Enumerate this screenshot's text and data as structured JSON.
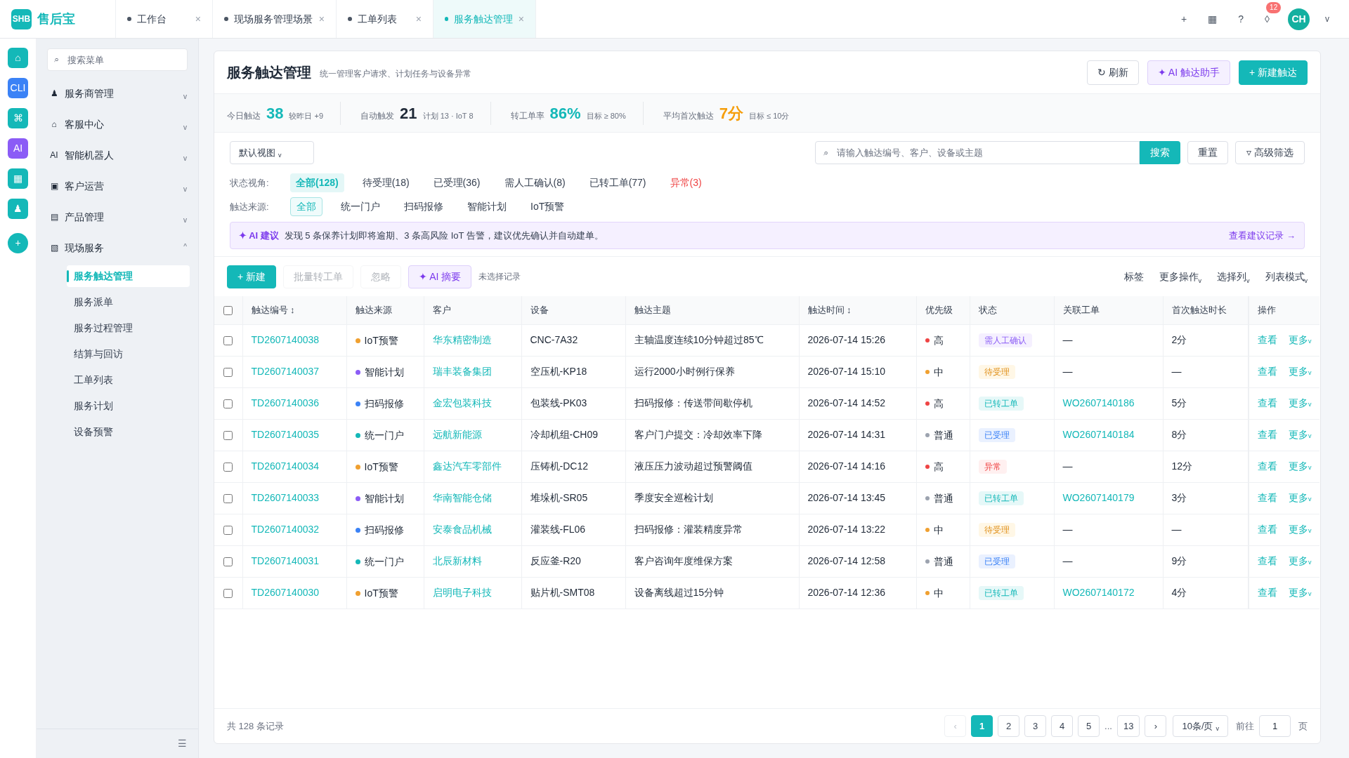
{
  "app": {
    "logo": "SHB",
    "name": "售后宝"
  },
  "tabs": [
    {
      "label": "工作台",
      "selected": false,
      "close": "×"
    },
    {
      "label": "现场服务管理场景",
      "selected": false,
      "close": "×"
    },
    {
      "label": "工单列表",
      "selected": false,
      "close": "×"
    },
    {
      "label": "服务触达管理",
      "selected": true,
      "close": "×"
    }
  ],
  "topbar": {
    "actions": [
      "+",
      "▦",
      "?",
      "◊"
    ],
    "badge": "12",
    "avatar": "CH",
    "caret": "v"
  },
  "rail": [
    {
      "text": "⌂",
      "color": "#14b8b8"
    },
    {
      "text": "CLI",
      "color": "#3b82f6"
    },
    {
      "text": "⌘",
      "color": "#14b8b8"
    },
    {
      "text": "AI",
      "color": "#8b5cf6"
    },
    {
      "text": "▦",
      "color": "#14b8b8"
    },
    {
      "text": "♟",
      "color": "#14b8b8"
    },
    {
      "text": "+",
      "color": "#14b8b8"
    }
  ],
  "sidebar": {
    "search": {
      "icon": "⌕",
      "placeholder": "搜索菜单"
    },
    "items": [
      {
        "icon": "♟",
        "label": "服务商管理",
        "expanded": false,
        "caret": "v"
      },
      {
        "icon": "⌂",
        "label": "客服中心",
        "expanded": false,
        "caret": "v"
      },
      {
        "icon": "AI",
        "label": "智能机器人",
        "expanded": false,
        "caret": "v"
      },
      {
        "icon": "▣",
        "label": "客户运营",
        "expanded": false,
        "caret": "v"
      },
      {
        "icon": "▤",
        "label": "产品管理",
        "expanded": false,
        "caret": "v"
      },
      {
        "icon": "▧",
        "label": "现场服务",
        "expanded": true,
        "caret": "^",
        "children": [
          {
            "label": "服务触达管理",
            "selected": true
          },
          {
            "label": "服务派单",
            "selected": false
          },
          {
            "label": "服务过程管理",
            "selected": false
          },
          {
            "label": "结算与回访",
            "selected": false
          },
          {
            "label": "工单列表",
            "selected": false
          },
          {
            "label": "服务计划",
            "selected": false
          },
          {
            "label": "设备预警",
            "selected": false
          }
        ]
      }
    ],
    "collapse": "☰"
  },
  "page": {
    "title": "服务触达管理",
    "subtitle": "统一管理客户请求、计划任务与设备异常",
    "buttons": [
      {
        "kind": "plain",
        "icon": "↻",
        "label": "刷新"
      },
      {
        "kind": "ai",
        "icon": "✦",
        "label": "AI 触达助手"
      },
      {
        "kind": "primary",
        "icon": "+",
        "label": "新建触达"
      }
    ]
  },
  "stats": [
    {
      "label": "今日触达",
      "value": "38",
      "note": "较昨日 +9",
      "color": "#14b8b8"
    },
    {
      "label": "自动触发",
      "value": "21",
      "note": "计划 13 · IoT 8",
      "color": "#1f2937"
    },
    {
      "label": "转工单率",
      "value": "86%",
      "note": "目标 ≥ 80%",
      "color": "#14b8b8"
    },
    {
      "label": "平均首次触达",
      "value": "7分",
      "note": "目标 ≤ 10分",
      "color": "#f59e0b"
    }
  ],
  "filters": {
    "view": "默认视图",
    "view_caret": "v",
    "search": {
      "icon": "⌕",
      "placeholder": "请输入触达编号、客户、设备或主题",
      "button": "搜索"
    },
    "reset": "重置",
    "advanced": "▿ 高级筛选",
    "status_label": "状态视角:",
    "statuses": [
      {
        "label": "全部(128)",
        "selected": true,
        "kind": "normal"
      },
      {
        "label": "待受理(18)",
        "selected": false,
        "kind": "normal"
      },
      {
        "label": "已受理(36)",
        "selected": false,
        "kind": "normal"
      },
      {
        "label": "需人工确认(8)",
        "selected": false,
        "kind": "normal"
      },
      {
        "label": "已转工单(77)",
        "selected": false,
        "kind": "normal"
      },
      {
        "label": "异常(3)",
        "selected": false,
        "kind": "alert"
      }
    ],
    "source_label": "触达来源:",
    "sources": [
      {
        "label": "全部",
        "selected": true
      },
      {
        "label": "统一门户",
        "selected": false
      },
      {
        "label": "扫码报修",
        "selected": false
      },
      {
        "label": "智能计划",
        "selected": false
      },
      {
        "label": "IoT预警",
        "selected": false
      }
    ]
  },
  "ai_banner": {
    "tag": "✦ AI 建议",
    "text": "发现 5 条保养计划即将逾期、3 条高风险 IoT 告警，建议优先确认并自动建单。",
    "link": "查看建议记录 →"
  },
  "toolbar": {
    "buttons": [
      {
        "kind": "primary",
        "label": "+ 新建",
        "disabled": false
      },
      {
        "kind": "plain",
        "label": "批量转工单",
        "disabled": true
      },
      {
        "kind": "plain",
        "label": "忽略",
        "disabled": true
      },
      {
        "kind": "ai",
        "label": "✦ AI 摘要",
        "disabled": false
      }
    ],
    "hint": "未选择记录",
    "menus": [
      {
        "label": "标签"
      },
      {
        "label": "更多操作",
        "caret": "v"
      },
      {
        "label": "选择列",
        "caret": "v"
      },
      {
        "label": "列表模式",
        "caret": "v"
      }
    ]
  },
  "table": {
    "select_all": false,
    "columns": [
      {
        "label": "触达编号",
        "sort": "↕"
      },
      {
        "label": "触达来源"
      },
      {
        "label": "客户"
      },
      {
        "label": "设备"
      },
      {
        "label": "触达主题"
      },
      {
        "label": "触达时间",
        "sort": "↕"
      },
      {
        "label": "优先级"
      },
      {
        "label": "状态"
      },
      {
        "label": "关联工单"
      },
      {
        "label": "首次触达时长"
      },
      {
        "label": "操作"
      }
    ],
    "rows": [
      {
        "checked": false,
        "id": "TD2607140038",
        "source": {
          "label": "IoT预警",
          "color": "#f0a030"
        },
        "customer": "华东精密制造",
        "device": "CNC-7A32",
        "subject": "主轴温度连续10分钟超过85℃",
        "time": "2026-07-14 15:26",
        "priority": {
          "label": "高",
          "color": "#ef4444"
        },
        "status": {
          "label": "需人工确认",
          "kind": "confirm"
        },
        "order": "—",
        "duration": "2分",
        "view": "查看",
        "more": "更多",
        "more_caret": "v"
      },
      {
        "checked": false,
        "id": "TD2607140037",
        "source": {
          "label": "智能计划",
          "color": "#8b5cf6"
        },
        "customer": "瑞丰装备集团",
        "device": "空压机-KP18",
        "subject": "运行2000小时例行保养",
        "time": "2026-07-14 15:10",
        "priority": {
          "label": "中",
          "color": "#f0a030"
        },
        "status": {
          "label": "待受理",
          "kind": "pending"
        },
        "order": "—",
        "duration": "—",
        "view": "查看",
        "more": "更多",
        "more_caret": "v"
      },
      {
        "checked": false,
        "id": "TD2607140036",
        "source": {
          "label": "扫码报修",
          "color": "#3b82f6"
        },
        "customer": "金宏包装科技",
        "device": "包装线-PK03",
        "subject": "扫码报修：传送带间歇停机",
        "time": "2026-07-14 14:52",
        "priority": {
          "label": "高",
          "color": "#ef4444"
        },
        "status": {
          "label": "已转工单",
          "kind": "converted"
        },
        "order": "WO2607140186",
        "duration": "5分",
        "view": "查看",
        "more": "更多",
        "more_caret": "v"
      },
      {
        "checked": false,
        "id": "TD2607140035",
        "source": {
          "label": "统一门户",
          "color": "#14b8b8"
        },
        "customer": "远航新能源",
        "device": "冷却机组-CH09",
        "subject": "客户门户提交：冷却效率下降",
        "time": "2026-07-14 14:31",
        "priority": {
          "label": "普通",
          "color": "#9ca3af"
        },
        "status": {
          "label": "已受理",
          "kind": "accepted"
        },
        "order": "WO2607140184",
        "duration": "8分",
        "view": "查看",
        "more": "更多",
        "more_caret": "v"
      },
      {
        "checked": false,
        "id": "TD2607140034",
        "source": {
          "label": "IoT预警",
          "color": "#f0a030"
        },
        "customer": "鑫达汽车零部件",
        "device": "压铸机-DC12",
        "subject": "液压压力波动超过预警阈值",
        "time": "2026-07-14 14:16",
        "priority": {
          "label": "高",
          "color": "#ef4444"
        },
        "status": {
          "label": "异常",
          "kind": "abnormal"
        },
        "order": "—",
        "duration": "12分",
        "view": "查看",
        "more": "更多",
        "more_caret": "v"
      },
      {
        "checked": false,
        "id": "TD2607140033",
        "source": {
          "label": "智能计划",
          "color": "#8b5cf6"
        },
        "customer": "华南智能仓储",
        "device": "堆垛机-SR05",
        "subject": "季度安全巡检计划",
        "time": "2026-07-14 13:45",
        "priority": {
          "label": "普通",
          "color": "#9ca3af"
        },
        "status": {
          "label": "已转工单",
          "kind": "converted"
        },
        "order": "WO2607140179",
        "duration": "3分",
        "view": "查看",
        "more": "更多",
        "more_caret": "v"
      },
      {
        "checked": false,
        "id": "TD2607140032",
        "source": {
          "label": "扫码报修",
          "color": "#3b82f6"
        },
        "customer": "安泰食品机械",
        "device": "灌装线-FL06",
        "subject": "扫码报修：灌装精度异常",
        "time": "2026-07-14 13:22",
        "priority": {
          "label": "中",
          "color": "#f0a030"
        },
        "status": {
          "label": "待受理",
          "kind": "pending"
        },
        "order": "—",
        "duration": "—",
        "view": "查看",
        "more": "更多",
        "more_caret": "v"
      },
      {
        "checked": false,
        "id": "TD2607140031",
        "source": {
          "label": "统一门户",
          "color": "#14b8b8"
        },
        "customer": "北辰新材料",
        "device": "反应釜-R20",
        "subject": "客户咨询年度维保方案",
        "time": "2026-07-14 12:58",
        "priority": {
          "label": "普通",
          "color": "#9ca3af"
        },
        "status": {
          "label": "已受理",
          "kind": "accepted"
        },
        "order": "—",
        "duration": "9分",
        "view": "查看",
        "more": "更多",
        "more_caret": "v"
      },
      {
        "checked": false,
        "id": "TD2607140030",
        "source": {
          "label": "IoT预警",
          "color": "#f0a030"
        },
        "customer": "启明电子科技",
        "device": "贴片机-SMT08",
        "subject": "设备离线超过15分钟",
        "time": "2026-07-14 12:36",
        "priority": {
          "label": "中",
          "color": "#f0a030"
        },
        "status": {
          "label": "已转工单",
          "kind": "converted"
        },
        "order": "WO2607140172",
        "duration": "4分",
        "view": "查看",
        "more": "更多",
        "more_caret": "v"
      }
    ]
  },
  "pagination": {
    "total": "共 128 条记录",
    "prev": "‹",
    "pages": [
      {
        "label": "1",
        "selected": true
      },
      {
        "label": "2",
        "selected": false
      },
      {
        "label": "3",
        "selected": false
      },
      {
        "label": "4",
        "selected": false
      },
      {
        "label": "5",
        "selected": false
      }
    ],
    "ellipsis": "...",
    "last_pages": [
      {
        "label": "13",
        "selected": false
      }
    ],
    "next": "›",
    "page_size": "10条/页",
    "page_size_caret": "v",
    "goto": "前往",
    "goto_value": "1",
    "page_unit": "页"
  }
}
